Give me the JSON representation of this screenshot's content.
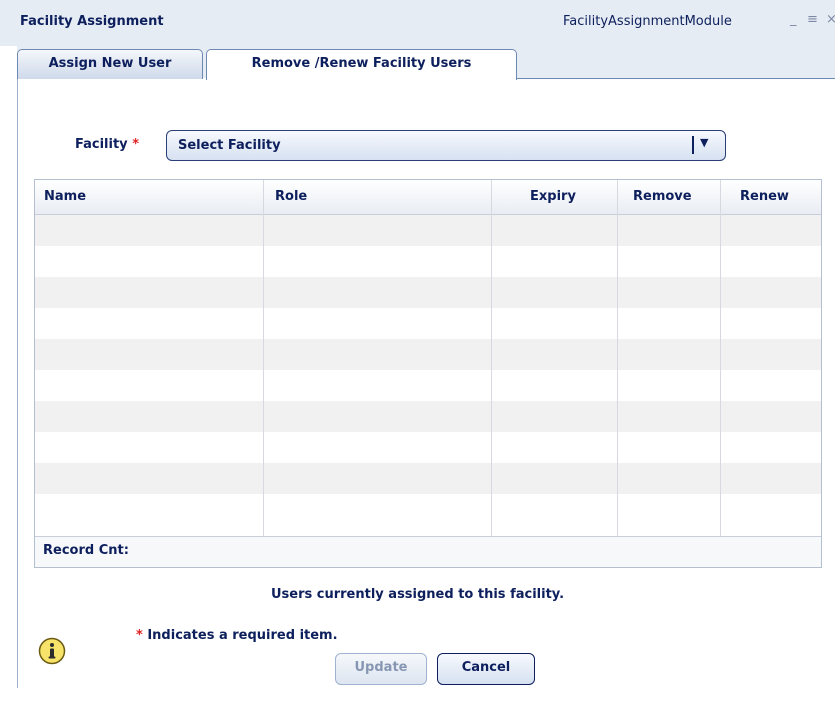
{
  "window": {
    "title": "Facility Assignment",
    "module_name": "FacilityAssignmentModule",
    "minimize_glyph": "_",
    "menu_glyph": "≡",
    "close_glyph": "×"
  },
  "tabs": [
    {
      "label": "Assign New User",
      "active": false
    },
    {
      "label": "Remove /Renew Facility Users",
      "active": true
    }
  ],
  "facility": {
    "label": "Facility",
    "required_marker": "*",
    "selected": "Select Facility"
  },
  "grid": {
    "columns": [
      "Name",
      "Role",
      "Expiry",
      "Remove",
      "Renew"
    ],
    "rows": [],
    "footer_label": "Record Cnt:"
  },
  "caption": "Users currently assigned to this facility.",
  "required_note": {
    "marker": "*",
    "text": "Indicates a required item."
  },
  "buttons": {
    "update": "Update",
    "cancel": "Cancel"
  },
  "icons": {
    "info": "info-icon",
    "dropdown": "chevron-down-icon"
  }
}
